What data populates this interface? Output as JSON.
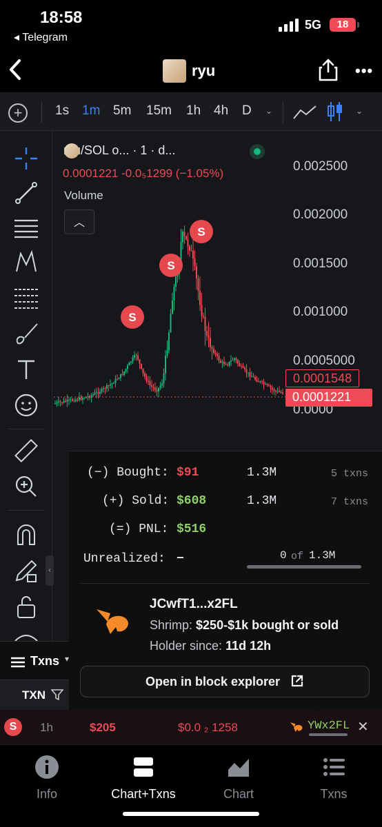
{
  "status": {
    "time": "18:58",
    "back_app": "◂ Telegram",
    "network": "5G",
    "battery": "18"
  },
  "nav": {
    "title": "ryu"
  },
  "toolbar": {
    "intervals": [
      "1s",
      "1m",
      "5m",
      "15m",
      "1h",
      "4h",
      "D"
    ],
    "active_interval": "1m"
  },
  "legend": {
    "title": "ryu/SOL o...   · 1 · d...",
    "values": "0.0001221  -0.0₅1299 (−1.05%)",
    "volume_label": "Volume"
  },
  "axis": {
    "ticks": [
      "0.002500",
      "0.002000",
      "0.001500",
      "0.001000",
      "0.0005000",
      "0.0000"
    ],
    "tag_upper": "0.0001548",
    "tag_current": "0.0001221"
  },
  "markers": [
    "S",
    "S",
    "S"
  ],
  "stats": {
    "bought_label": "(−) Bought:",
    "bought_amount": "$91",
    "bought_tokens": "1.3M",
    "bought_txns": "5 txns",
    "sold_label": "(+) Sold:",
    "sold_amount": "$608",
    "sold_tokens": "1.3M",
    "sold_txns": "7 txns",
    "pnl_label": "(=) PNL:",
    "pnl_amount": "$516",
    "unrealized_label": "Unrealized:",
    "unrealized_value": "−",
    "holding_left": "0",
    "holding_of": "of",
    "holding_total": "1.3M"
  },
  "wallet": {
    "name": "JCwfT1...x2FL",
    "tier_prefix": "Shrimp:",
    "tier": "$250-$1k bought or sold",
    "holder_prefix": "Holder since:",
    "holder_since": "11d 12h",
    "explorer_button": "Open in block explorer"
  },
  "txns_panel": {
    "title": "Txns",
    "column": "TXN"
  },
  "txn_row": {
    "side": "S",
    "age": "1h",
    "usd": "$205",
    "price": "$0.0 ₂ 1258",
    "maker": "YWx2FL"
  },
  "tabs": [
    {
      "label": "Info",
      "icon": "info-icon"
    },
    {
      "label": "Chart+Txns",
      "icon": "split-view-icon"
    },
    {
      "label": "Chart",
      "icon": "chart-icon"
    },
    {
      "label": "Txns",
      "icon": "list-icon"
    }
  ],
  "colors": {
    "up": "#16b67e",
    "down": "#ef4a55",
    "accent": "#3b82f6",
    "pnl": "#8fd06a"
  }
}
